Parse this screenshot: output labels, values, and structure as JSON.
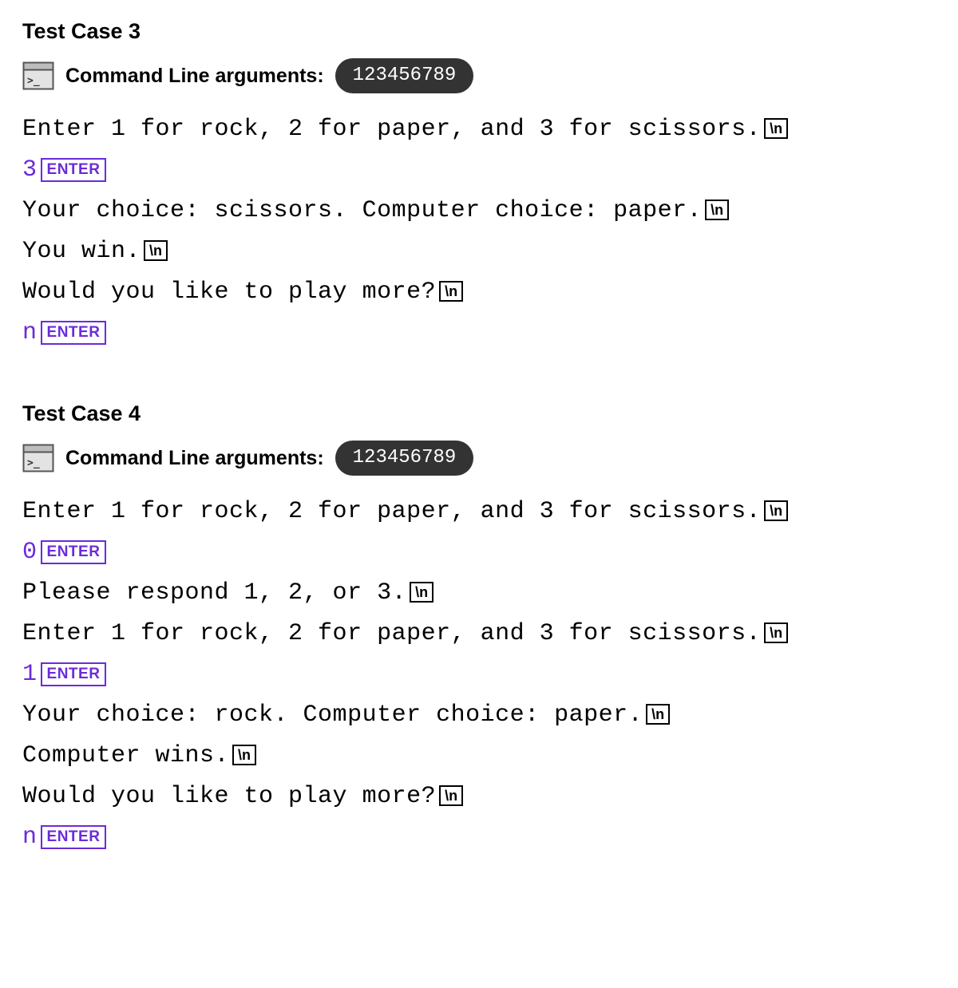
{
  "labels": {
    "command_line_arguments": "Command Line arguments:",
    "newline_badge": "\\n",
    "enter_badge": "ENTER"
  },
  "test_cases": [
    {
      "title": "Test Case 3",
      "args": "123456789",
      "lines": [
        {
          "type": "output",
          "text": "Enter 1 for rock, 2 for paper, and 3 for scissors.",
          "newline": true
        },
        {
          "type": "input",
          "text": "3",
          "enter": true
        },
        {
          "type": "output",
          "text": "Your choice: scissors. Computer choice: paper.",
          "newline": true
        },
        {
          "type": "output",
          "text": "You win.",
          "newline": true
        },
        {
          "type": "output",
          "text": "Would you like to play more?",
          "newline": true
        },
        {
          "type": "input",
          "text": "n",
          "enter": true
        }
      ]
    },
    {
      "title": "Test Case 4",
      "args": "123456789",
      "lines": [
        {
          "type": "output",
          "text": "Enter 1 for rock, 2 for paper, and 3 for scissors.",
          "newline": true
        },
        {
          "type": "input",
          "text": "0",
          "enter": true
        },
        {
          "type": "output",
          "text": "Please respond 1, 2, or 3.",
          "newline": true
        },
        {
          "type": "output",
          "text": "Enter 1 for rock, 2 for paper, and 3 for scissors.",
          "newline": true
        },
        {
          "type": "input",
          "text": "1",
          "enter": true
        },
        {
          "type": "output",
          "text": "Your choice: rock. Computer choice: paper.",
          "newline": true
        },
        {
          "type": "output",
          "text": "Computer wins.",
          "newline": true
        },
        {
          "type": "output",
          "text": "Would you like to play more?",
          "newline": true
        },
        {
          "type": "input",
          "text": "n",
          "enter": true
        }
      ]
    }
  ]
}
